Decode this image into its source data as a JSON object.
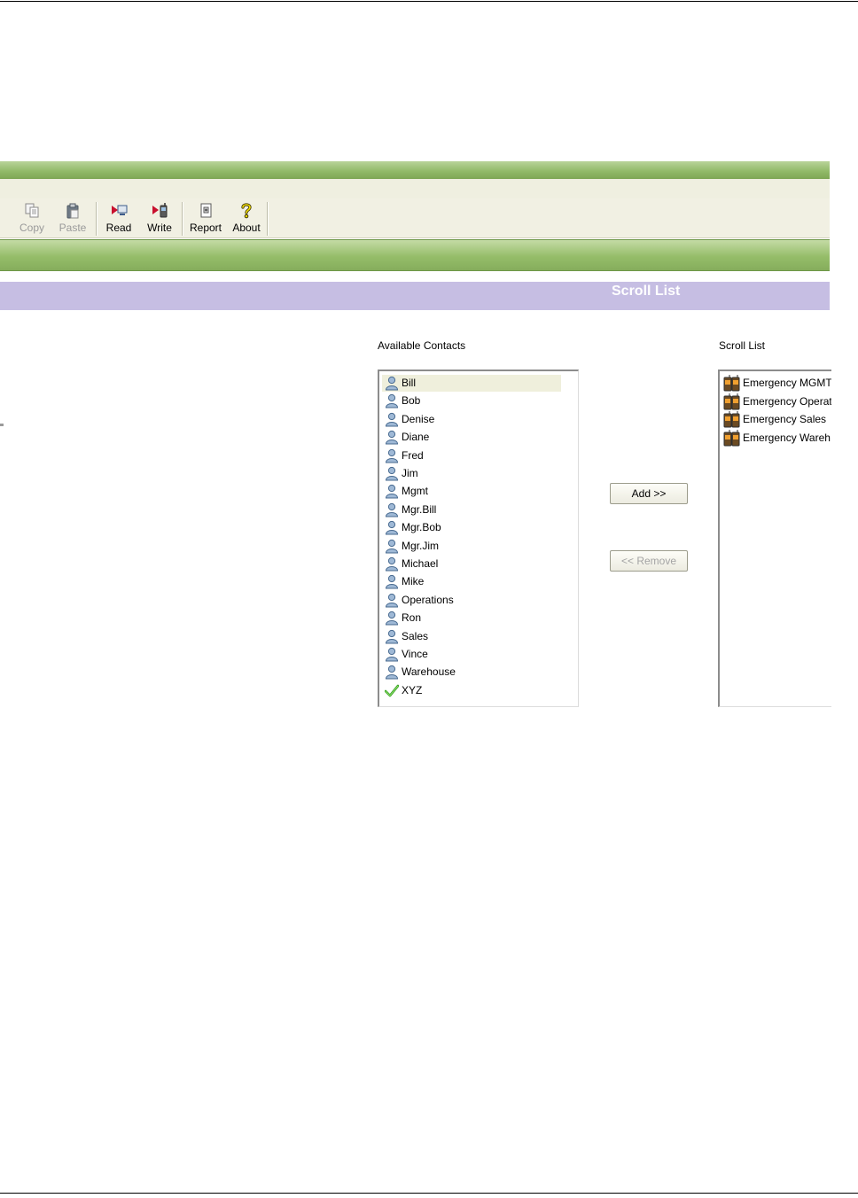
{
  "toolbar": {
    "copy_label": "Copy",
    "paste_label": "Paste",
    "read_label": "Read",
    "write_label": "Write",
    "report_label": "Report",
    "about_label": "About"
  },
  "section": {
    "title": "Scroll List"
  },
  "available_contacts": {
    "label": "Available Contacts",
    "items": [
      {
        "name": "Bill",
        "icon": "person-icon"
      },
      {
        "name": "Bob",
        "icon": "person-icon"
      },
      {
        "name": "Denise",
        "icon": "person-icon"
      },
      {
        "name": "Diane",
        "icon": "person-icon"
      },
      {
        "name": "Fred",
        "icon": "person-icon"
      },
      {
        "name": "Jim",
        "icon": "person-icon"
      },
      {
        "name": "Mgmt",
        "icon": "person-icon"
      },
      {
        "name": "Mgr.Bill",
        "icon": "person-icon"
      },
      {
        "name": "Mgr.Bob",
        "icon": "person-icon"
      },
      {
        "name": "Mgr.Jim",
        "icon": "person-icon"
      },
      {
        "name": "Michael",
        "icon": "person-icon"
      },
      {
        "name": "Mike",
        "icon": "person-icon"
      },
      {
        "name": "Operations",
        "icon": "person-icon"
      },
      {
        "name": "Ron",
        "icon": "person-icon"
      },
      {
        "name": "Sales",
        "icon": "person-icon"
      },
      {
        "name": "Vince",
        "icon": "person-icon"
      },
      {
        "name": "Warehouse",
        "icon": "person-icon"
      },
      {
        "name": "XYZ",
        "icon": "checkmark-icon"
      }
    ],
    "selected_index": 0
  },
  "buttons": {
    "add_label": "Add >>",
    "remove_label": "<< Remove"
  },
  "scroll_list": {
    "label": "Scroll List",
    "items": [
      {
        "name": "Emergency MGMT",
        "icon": "radio-icon"
      },
      {
        "name": "Emergency Operat",
        "icon": "radio-icon"
      },
      {
        "name": "Emergency Sales",
        "icon": "radio-icon"
      },
      {
        "name": "Emergency Wareh",
        "icon": "radio-icon"
      }
    ]
  },
  "colors": {
    "app_green": "#8fb866",
    "section_header": "#c6bee3",
    "selection": "#efefdc"
  }
}
